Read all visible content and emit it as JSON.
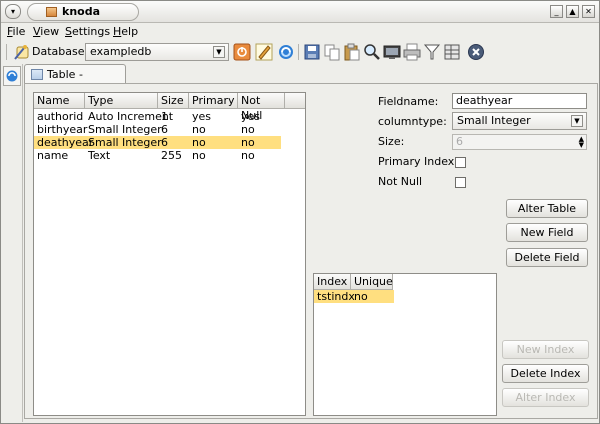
{
  "window": {
    "title": "knoda"
  },
  "menubar": {
    "items": [
      {
        "label": "File",
        "mnemonic": "F",
        "rest": "ile"
      },
      {
        "label": "View",
        "mnemonic": "V",
        "rest": "iew"
      },
      {
        "label": "Settings",
        "mnemonic": "S",
        "rest": "ettings"
      },
      {
        "label": "Help",
        "mnemonic": "H",
        "rest": "elp"
      }
    ]
  },
  "toolbar": {
    "database_label": "Database:",
    "database_value": "exampledb",
    "icons": [
      "disconnect-icon",
      "edit-icon",
      "refresh-icon",
      "save-icon",
      "copy-icon",
      "paste-icon",
      "find-icon",
      "monitor-icon",
      "print-icon",
      "filter-icon",
      "table-properties-icon",
      "close-icon"
    ]
  },
  "doc_tab": {
    "label": "Table - authors"
  },
  "fields_table": {
    "columns": [
      "Name",
      "Type",
      "Size",
      "Primary",
      "Not Null"
    ],
    "rows": [
      [
        "authorid",
        "Auto Increment",
        "1",
        "yes",
        "yes"
      ],
      [
        "birthyear",
        "Small Integer",
        "6",
        "no",
        "no"
      ],
      [
        "deathyear",
        "Small Integer",
        "6",
        "no",
        "no"
      ],
      [
        "name",
        "Text",
        "255",
        "no",
        "no"
      ]
    ],
    "selected_row": 2
  },
  "form": {
    "fieldname_label": "Fieldname:",
    "fieldname_value": "deathyear",
    "columntype_label": "columntype:",
    "columntype_value": "Small Integer",
    "size_label": "Size:",
    "size_value": "6",
    "primary_index_label": "Primary Index",
    "not_null_label": "Not Null"
  },
  "buttons": {
    "alter_table": "Alter Table",
    "new_field": "New Field",
    "delete_field": "Delete Field",
    "new_index": "New Index",
    "delete_index": "Delete Index",
    "alter_index": "Alter Index"
  },
  "index_table": {
    "columns": [
      "Index",
      "Unique"
    ],
    "rows": [
      [
        "tstindx",
        "no"
      ]
    ]
  },
  "colors": {
    "selection": "#ffdf80",
    "window_bg": "#eeeeea"
  }
}
